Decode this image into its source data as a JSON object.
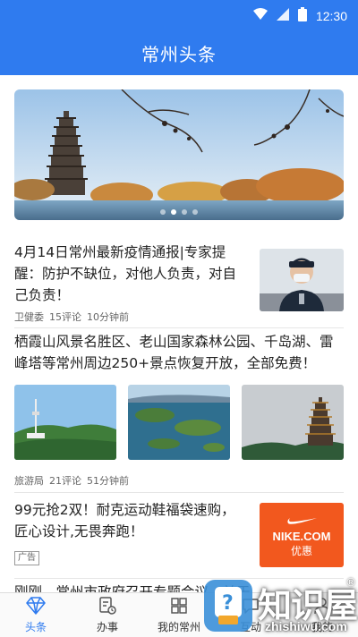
{
  "status": {
    "time": "12:30"
  },
  "header": {
    "title": "常州头条"
  },
  "banner": {
    "dots": 4,
    "active_dot": 1
  },
  "news": [
    {
      "title": "4月14日常州最新疫情通报|专家提醒：防护不缺位，对他人负责，对自己负责！",
      "source": "卫健委",
      "comments": "15评论",
      "time": "10分钟前"
    },
    {
      "title": "栖霞山风景名胜区、老山国家森林公园、千岛湖、雷峰塔等常州周边250+景点恢复开放，全部免费！",
      "source": "旅游局",
      "comments": "21评论",
      "time": "51分钟前"
    },
    {
      "title": "99元抢2双！耐克运动鞋福袋速购，匠心设计,无畏奔跑！",
      "ad_tag": "广告",
      "ad_brand": "NIKE.COM",
      "ad_sub": "优惠"
    },
    {
      "title": "刚刚，常州市政府召开专题会议，关于"
    }
  ],
  "tabs": [
    {
      "label": "头条",
      "icon": "diamond-icon"
    },
    {
      "label": "办事",
      "icon": "document-clock-icon"
    },
    {
      "label": "我的常州",
      "icon": "grid-icon"
    },
    {
      "label": "互动",
      "icon": "chat-icon"
    },
    {
      "label": "我的",
      "icon": "person-icon"
    }
  ],
  "watermark": {
    "cn": "知识屋",
    "url": "zhishiwu.com",
    "reg": "®"
  }
}
